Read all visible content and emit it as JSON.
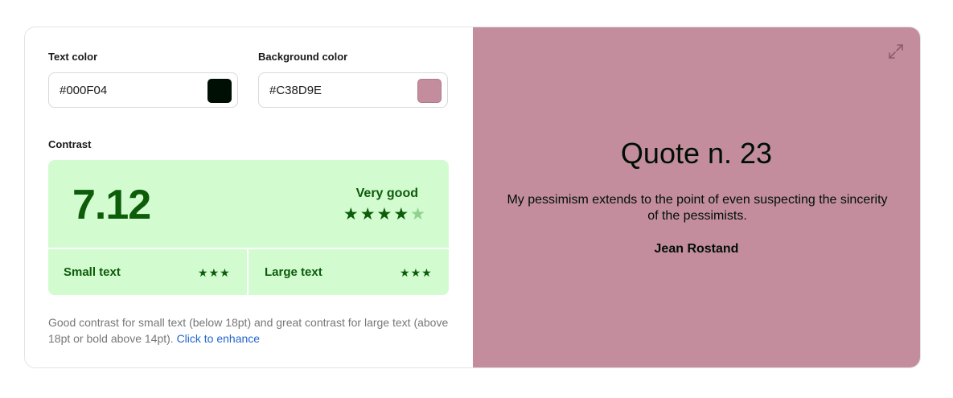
{
  "inputs": {
    "text_color": {
      "label": "Text color",
      "value": "#000F04",
      "swatch": "#000F04"
    },
    "background_color": {
      "label": "Background color",
      "value": "#C38D9E",
      "swatch": "#C38D9E"
    }
  },
  "contrast": {
    "label": "Contrast",
    "ratio": "7.12",
    "rating": "Very good",
    "stars_filled": 4,
    "stars_total": 5,
    "small_text": {
      "label": "Small text",
      "stars": 3
    },
    "large_text": {
      "label": "Large text",
      "stars": 3
    },
    "description": "Good contrast for small text (below 18pt) and great contrast for large text (above 18pt or bold above 14pt).",
    "enhance_link": "Click to enhance",
    "colors": {
      "box_bg": "#d2fbd0",
      "accent": "#0d5c0a"
    }
  },
  "preview": {
    "title": "Quote n. 23",
    "quote": "My pessimism extends to the point of even suspecting the sincerity of the pessimists.",
    "author": "Jean Rostand",
    "expand_icon": "expand-icon"
  }
}
